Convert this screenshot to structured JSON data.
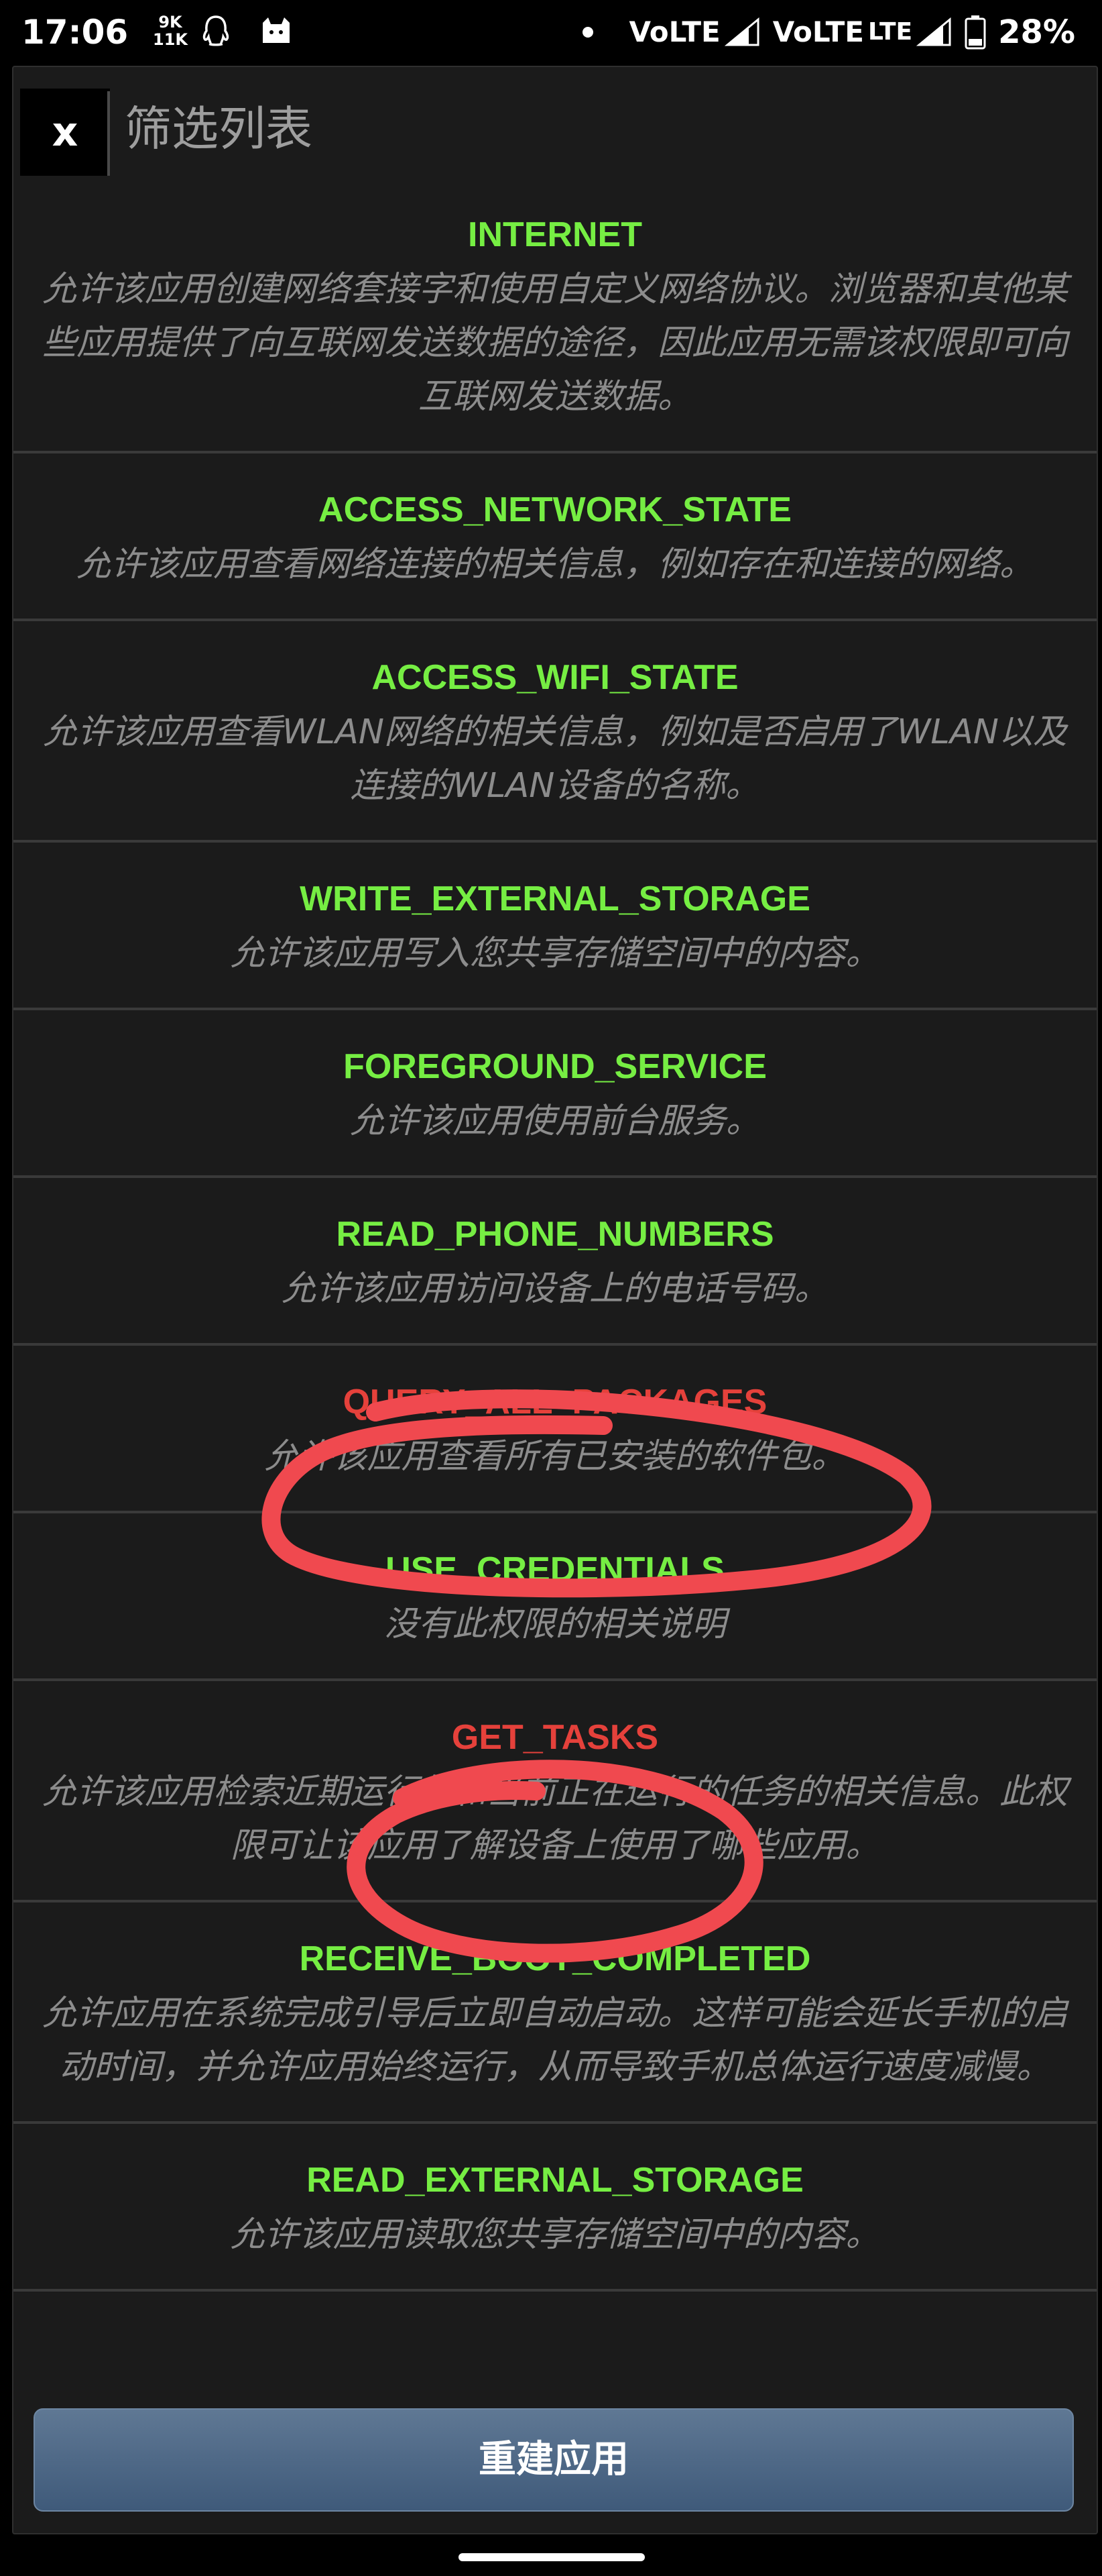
{
  "status_bar": {
    "time": "17:06",
    "net_speed_top": "9K",
    "net_speed_bottom": "11K",
    "sim1": "VoLTE",
    "sim2": "VoLTE",
    "network_type": "LTE",
    "battery": "28%"
  },
  "dialog": {
    "close_label": "x",
    "title": "筛选列表"
  },
  "permissions": [
    {
      "name": "INTERNET",
      "highlighted": false,
      "desc": "允许该应用创建网络套接字和使用自定义网络协议。浏览器和其他某些应用提供了向互联网发送数据的途径，因此应用无需该权限即可向互联网发送数据。"
    },
    {
      "name": "ACCESS_NETWORK_STATE",
      "highlighted": false,
      "desc": "允许该应用查看网络连接的相关信息，例如存在和连接的网络。"
    },
    {
      "name": "ACCESS_WIFI_STATE",
      "highlighted": false,
      "desc": "允许该应用查看WLAN网络的相关信息，例如是否启用了WLAN以及连接的WLAN设备的名称。"
    },
    {
      "name": "WRITE_EXTERNAL_STORAGE",
      "highlighted": false,
      "desc": "允许该应用写入您共享存储空间中的内容。"
    },
    {
      "name": "FOREGROUND_SERVICE",
      "highlighted": false,
      "desc": "允许该应用使用前台服务。"
    },
    {
      "name": "READ_PHONE_NUMBERS",
      "highlighted": false,
      "desc": "允许该应用访问设备上的电话号码。"
    },
    {
      "name": "QUERY_ALL_PACKAGES",
      "highlighted": true,
      "desc": "允许该应用查看所有已安装的软件包。"
    },
    {
      "name": "USE_CREDENTIALS",
      "highlighted": false,
      "desc": "没有此权限的相关说明"
    },
    {
      "name": "GET_TASKS",
      "highlighted": true,
      "desc": "允许该应用检索近期运行的和当前正在运行的任务的相关信息。此权限可让该应用了解设备上使用了哪些应用。"
    },
    {
      "name": "RECEIVE_BOOT_COMPLETED",
      "highlighted": false,
      "desc": "允许应用在系统完成引导后立即自动启动。这样可能会延长手机的启动时间，并允许应用始终运行，从而导致手机总体运行速度减慢。"
    },
    {
      "name": "READ_EXTERNAL_STORAGE",
      "highlighted": false,
      "desc": "允许该应用读取您共享存储空间中的内容。"
    }
  ],
  "footer": {
    "rebuild_label": "重建应用"
  },
  "colors": {
    "permission_name": "#76ee43",
    "permission_name_highlighted": "#e5413b",
    "annotation_stroke": "#f0494f",
    "description": "#8c8c8c",
    "dialog_background": "#1b1b1b"
  }
}
